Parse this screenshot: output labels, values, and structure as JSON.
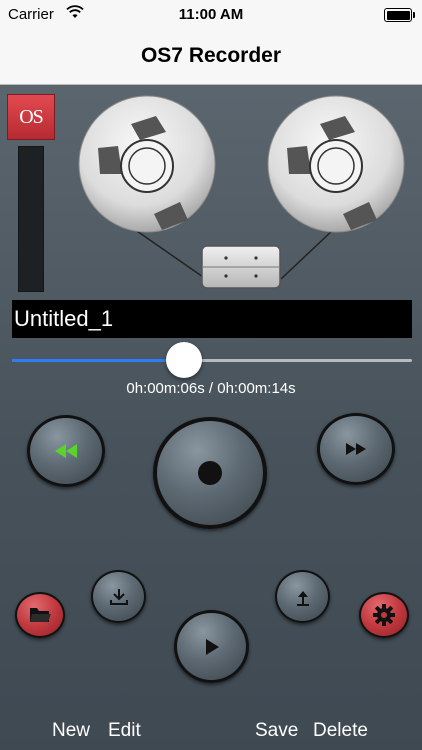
{
  "status_bar": {
    "carrier": "Carrier",
    "time": "11:00 AM"
  },
  "nav": {
    "title": "OS7 Recorder"
  },
  "logo": {
    "text": "OS"
  },
  "recording": {
    "name": "Untitled_1",
    "time_readout": "0h:00m:06s / 0h:00m:14s",
    "progress": 0.43
  },
  "labels": {
    "new": "New",
    "edit": "Edit",
    "save": "Save",
    "delete": "Delete"
  },
  "colors": {
    "accent": "#2f7cf6",
    "rewind_icon": "#5ad32a",
    "red_button": "#c2393f"
  },
  "icons": {
    "rewind": "rewind-icon",
    "fast_forward": "fast-forward-icon",
    "record": "record-icon",
    "play": "play-icon",
    "folder": "folder-icon",
    "settings": "gear-icon",
    "download": "download-icon",
    "upload": "upload-icon"
  }
}
